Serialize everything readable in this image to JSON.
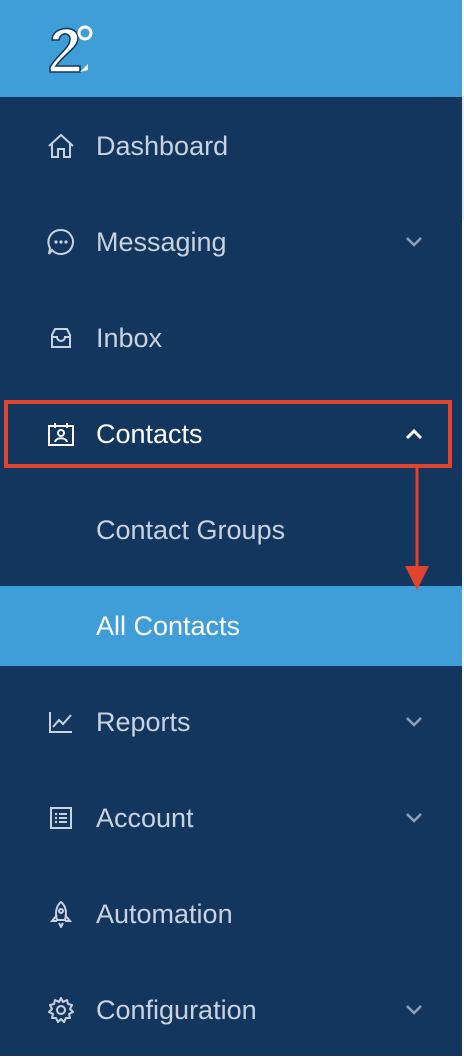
{
  "brand": {
    "logo_icon": "brand-logo-icon"
  },
  "colors": {
    "sidebar_bg": "#13365e",
    "accent": "#3f9ed8",
    "text": "#c9d2de",
    "active_text": "#ffffff",
    "annotation": "#e0442c"
  },
  "nav": {
    "dashboard": {
      "label": "Dashboard",
      "icon": "home-icon"
    },
    "messaging": {
      "label": "Messaging",
      "icon": "chat-bubble-icon",
      "expandable": true
    },
    "inbox": {
      "label": "Inbox",
      "icon": "inbox-icon"
    },
    "contacts": {
      "label": "Contacts",
      "icon": "contact-card-icon",
      "expanded": true
    },
    "contact_groups": {
      "label": "Contact Groups"
    },
    "all_contacts": {
      "label": "All Contacts",
      "selected": true
    },
    "reports": {
      "label": "Reports",
      "icon": "line-chart-icon",
      "expandable": true
    },
    "account": {
      "label": "Account",
      "icon": "list-document-icon",
      "expandable": true
    },
    "automation": {
      "label": "Automation",
      "icon": "rocket-icon"
    },
    "configuration": {
      "label": "Configuration",
      "icon": "gear-icon",
      "expandable": true
    }
  }
}
